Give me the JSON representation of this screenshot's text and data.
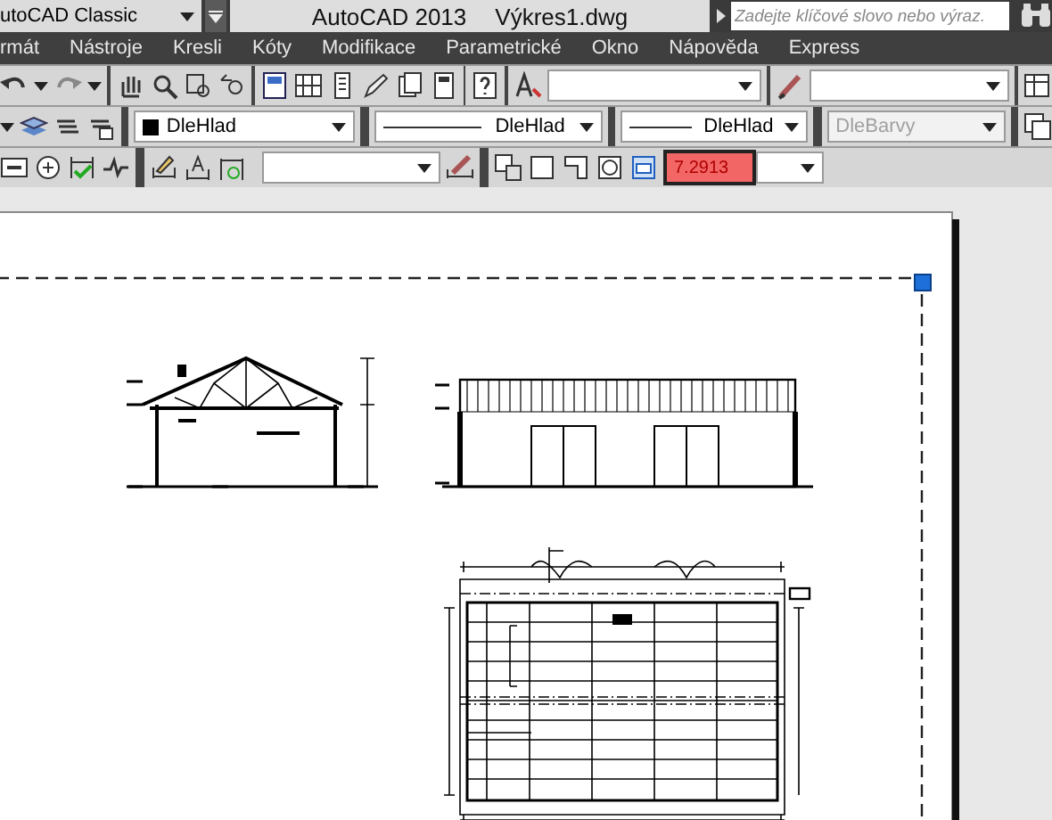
{
  "workspace": {
    "value": "utoCAD Classic"
  },
  "title": {
    "app": "AutoCAD 2013",
    "file": "Výkres1.dwg"
  },
  "search": {
    "placeholder": "Zadejte klíčové slovo nebo výraz."
  },
  "menu": [
    {
      "label": "rmát"
    },
    {
      "label": "Nástroje"
    },
    {
      "label": "Kresli"
    },
    {
      "label": "Kóty"
    },
    {
      "label": "Modifikace"
    },
    {
      "label": "Parametrické"
    },
    {
      "label": "Okno"
    },
    {
      "label": "Nápověda"
    },
    {
      "label": "Express"
    }
  ],
  "layer_toolbar": {
    "color_control": "DleHlad",
    "linetype": "DleHlad",
    "lineweight": "DleHlad",
    "plot_style": {
      "value": "DleBarvy",
      "disabled": true
    }
  },
  "dimension_toolbar": {
    "scale": "7.2913"
  }
}
